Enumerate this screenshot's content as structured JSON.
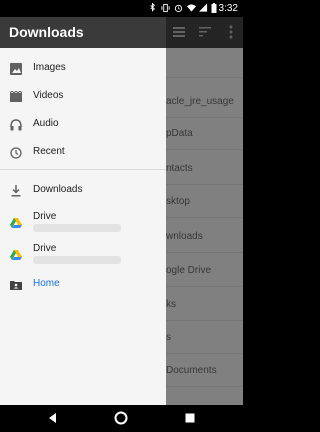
{
  "status_bar": {
    "time": "3:32",
    "icons": [
      "bluetooth-icon",
      "vibrate-icon",
      "alarm-icon",
      "wifi-icon",
      "signal-icon",
      "battery-icon"
    ]
  },
  "app_bar": {
    "actions": [
      "list-view-icon",
      "sort-icon",
      "more-options-icon"
    ]
  },
  "background_list": {
    "items": [
      "acle_jre_usage",
      "pData",
      "ntacts",
      "sktop",
      "wnloads",
      "ogle Drive",
      "ks",
      "s",
      "Documents"
    ]
  },
  "drawer": {
    "title": "Downloads",
    "items": [
      {
        "label": "Images",
        "icon": "image-icon"
      },
      {
        "label": "Videos",
        "icon": "video-icon"
      },
      {
        "label": "Audio",
        "icon": "headphones-icon"
      },
      {
        "label": "Recent",
        "icon": "clock-icon"
      },
      {
        "label": "Downloads",
        "icon": "download-icon"
      },
      {
        "label": "Drive",
        "icon": "google-drive-icon"
      },
      {
        "label": "Drive",
        "icon": "google-drive-icon"
      },
      {
        "label": "Home",
        "icon": "folder-account-icon"
      }
    ],
    "active_color": "#1a73e8"
  },
  "nav_bar": {
    "buttons": [
      "back-icon",
      "home-icon",
      "recents-icon"
    ]
  }
}
